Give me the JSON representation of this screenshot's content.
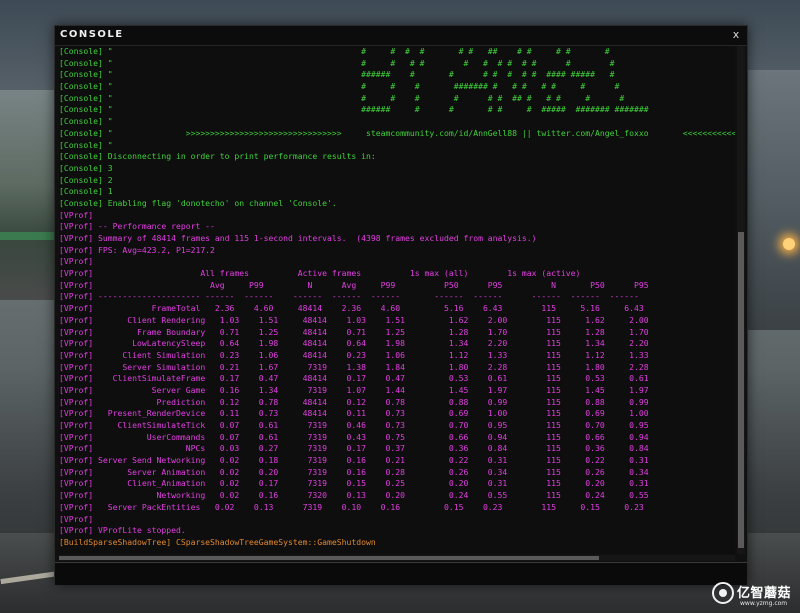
{
  "window": {
    "title": "CONSOLE",
    "close_label": "x"
  },
  "colors": {
    "green": "#3fd13a",
    "magenta": "#e23ee2",
    "orange": "#e08830",
    "background": "#101010"
  },
  "log": [
    {
      "cls": "c-green",
      "text": "[Console] \"                                                   #     #  #  #       # #   ##    # #     # #       #"
    },
    {
      "cls": "c-green",
      "text": "[Console] \"                                                   #     #   # #        #   #  # #  # #      #        #"
    },
    {
      "cls": "c-green",
      "text": "[Console] \"                                                   ######    #       #      # #  #  # #  #### #####   #"
    },
    {
      "cls": "c-green",
      "text": "[Console] \"                                                   #     #    #       ####### #   # #   # #     #      #"
    },
    {
      "cls": "c-green",
      "text": "[Console] \"                                                   #     #    #       #      # #  ## #   # #     #      #"
    },
    {
      "cls": "c-green",
      "text": "[Console] \"                                                   ######     #      #       # #     #  #####  ####### #######"
    },
    {
      "cls": "c-green",
      "text": "[Console] \""
    },
    {
      "cls": "c-green",
      "text": "[Console] \"               >>>>>>>>>>>>>>>>>>>>>>>>>>>>>>>>     steamcommunity.com/id/AnnGell88 || twitter.com/Angel_foxxo       <<<<<<<<<<<<<<"
    },
    {
      "cls": "c-green",
      "text": "[Console] \""
    },
    {
      "cls": "c-green",
      "text": "[Console] Disconnecting in order to print performance results in:"
    },
    {
      "cls": "c-green",
      "text": "[Console] 3"
    },
    {
      "cls": "c-green",
      "text": "[Console] 2"
    },
    {
      "cls": "c-green",
      "text": "[Console] 1"
    },
    {
      "cls": "c-green",
      "text": "[Console] Enabling flag 'donotecho' on channel 'Console'."
    },
    {
      "cls": "c-magenta",
      "text": "[VProf]"
    },
    {
      "cls": "c-magenta",
      "text": "[VProf] -- Performance report --"
    },
    {
      "cls": "c-magenta",
      "text": "[VProf] Summary of 48414 frames and 115 1-second intervals.  (4398 frames excluded from analysis.)"
    },
    {
      "cls": "c-magenta",
      "text": "[VProf] FPS: Avg=423.2, P1=217.2"
    },
    {
      "cls": "c-magenta",
      "text": "[VProf]"
    },
    {
      "cls": "c-magenta",
      "text": "[VProf]                      All frames          Active frames          1s max (all)        1s max (active)"
    },
    {
      "cls": "c-magenta",
      "text": "[VProf]                        Avg     P99         N      Avg     P99          P50      P95          N       P50      P95"
    },
    {
      "cls": "c-magenta",
      "text": "[VProf] --------------------- ------  ------    ------  ------  ------       ------  ------      ------  ------  ------"
    },
    {
      "cls": "c-magenta",
      "text": "[VProf]            FrameTotal   2.36    4.60     48414    2.36    4.60         5.16    6.43        115     5.16     6.43"
    },
    {
      "cls": "c-magenta",
      "text": "[VProf]       Client Rendering   1.03    1.51     48414    1.03    1.51         1.62    2.00        115     1.62     2.00"
    },
    {
      "cls": "c-magenta",
      "text": "[VProf]         Frame Boundary   0.71    1.25     48414    0.71    1.25         1.28    1.70        115     1.28     1.70"
    },
    {
      "cls": "c-magenta",
      "text": "[VProf]        LowLatencySleep   0.64    1.98     48414    0.64    1.98         1.34    2.20        115     1.34     2.20"
    },
    {
      "cls": "c-magenta",
      "text": "[VProf]      Client Simulation   0.23    1.06     48414    0.23    1.06         1.12    1.33        115     1.12     1.33"
    },
    {
      "cls": "c-magenta",
      "text": "[VProf]      Server Simulation   0.21    1.67      7319    1.38    1.84         1.80    2.28        115     1.80     2.28"
    },
    {
      "cls": "c-magenta",
      "text": "[VProf]    ClientSimulateFrame   0.17    0.47     48414    0.17    0.47         0.53    0.61        115     0.53     0.61"
    },
    {
      "cls": "c-magenta",
      "text": "[VProf]            Server Game   0.16    1.34      7319    1.07    1.44         1.45    1.97        115     1.45     1.97"
    },
    {
      "cls": "c-magenta",
      "text": "[VProf]             Prediction   0.12    0.78     48414    0.12    0.78         0.88    0.99        115     0.88     0.99"
    },
    {
      "cls": "c-magenta",
      "text": "[VProf]   Present_RenderDevice   0.11    0.73     48414    0.11    0.73         0.69    1.00        115     0.69     1.00"
    },
    {
      "cls": "c-magenta",
      "text": "[VProf]     ClientSimulateTick   0.07    0.61      7319    0.46    0.73         0.70    0.95        115     0.70     0.95"
    },
    {
      "cls": "c-magenta",
      "text": "[VProf]           UserCommands   0.07    0.61      7319    0.43    0.75         0.66    0.94        115     0.66     0.94"
    },
    {
      "cls": "c-magenta",
      "text": "[VProf]                   NPCs   0.03    0.27      7319    0.17    0.37         0.36    0.84        115     0.36     0.84"
    },
    {
      "cls": "c-magenta",
      "text": "[VProf] Server Send Networking   0.02    0.18      7319    0.16    0.21         0.22    0.31        115     0.22     0.31"
    },
    {
      "cls": "c-magenta",
      "text": "[VProf]       Server Animation   0.02    0.20      7319    0.16    0.28         0.26    0.34        115     0.26     0.34"
    },
    {
      "cls": "c-magenta",
      "text": "[VProf]       Client_Animation   0.02    0.17      7319    0.15    0.25         0.20    0.31        115     0.20     0.31"
    },
    {
      "cls": "c-magenta",
      "text": "[VProf]             Networking   0.02    0.16      7320    0.13    0.20         0.24    0.55        115     0.24     0.55"
    },
    {
      "cls": "c-magenta",
      "text": "[VProf]   Server PackEntities   0.02    0.13      7319    0.10    0.16         0.15    0.23        115     0.15     0.23"
    },
    {
      "cls": "c-magenta",
      "text": "[VProf]"
    },
    {
      "cls": "c-magenta",
      "text": "[VProf] VProfLite stopped."
    },
    {
      "cls": "c-orange",
      "text": "[BuildSparseShadowTree] CSparseShadowTreeGameSystem::GameShutdown"
    }
  ],
  "input": {
    "value": "",
    "placeholder": ""
  },
  "watermark": {
    "brand": "亿智蘑菇",
    "url": "www.yzmg.com"
  }
}
